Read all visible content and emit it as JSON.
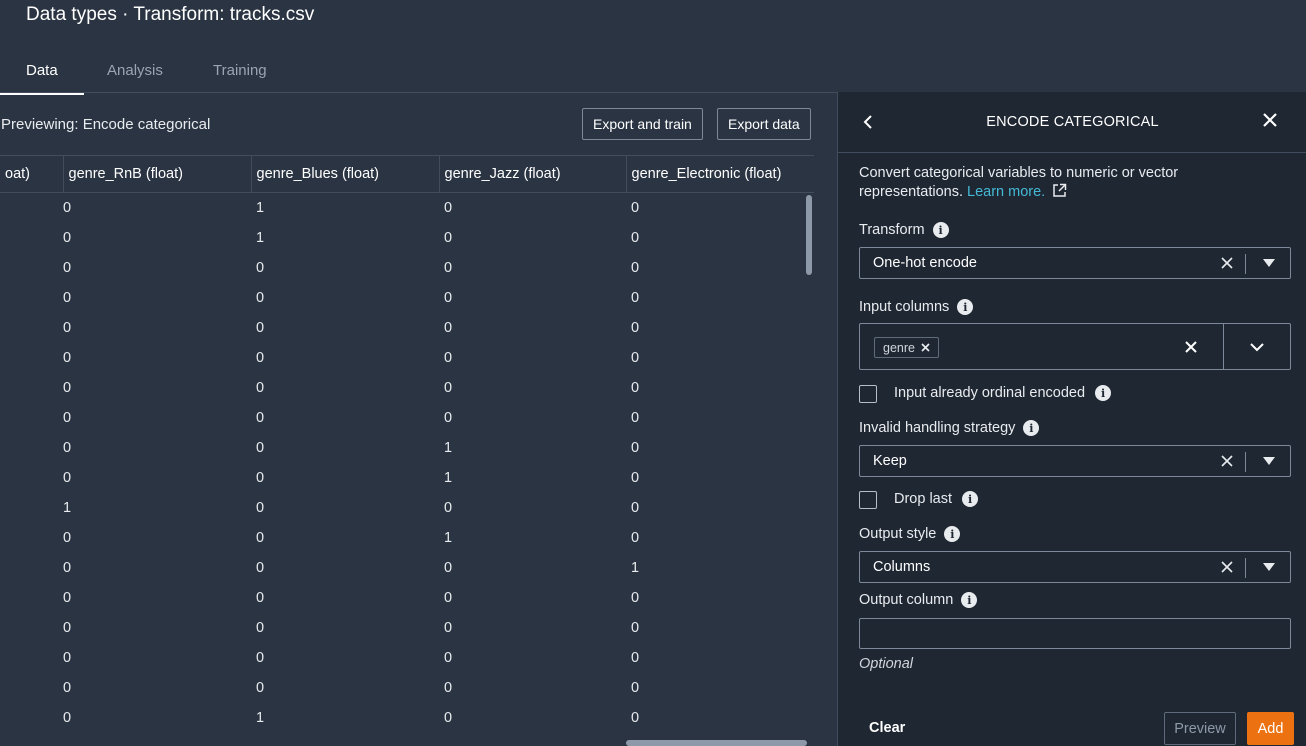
{
  "header": {
    "title": "Data types · Transform: tracks.csv"
  },
  "tabs": [
    {
      "label": "Data",
      "active": true
    },
    {
      "label": "Analysis",
      "active": false
    },
    {
      "label": "Training",
      "active": false
    }
  ],
  "preview": {
    "label": "Previewing: Encode categorical",
    "export_train_label": "Export and train",
    "export_data_label": "Export data"
  },
  "table": {
    "columns": [
      "oat)",
      "genre_RnB (float)",
      "genre_Blues (float)",
      "genre_Jazz (float)",
      "genre_Electronic (float)"
    ],
    "rows": [
      [
        "0",
        "1",
        "0",
        "0"
      ],
      [
        "0",
        "1",
        "0",
        "0"
      ],
      [
        "0",
        "0",
        "0",
        "0"
      ],
      [
        "0",
        "0",
        "0",
        "0"
      ],
      [
        "0",
        "0",
        "0",
        "0"
      ],
      [
        "0",
        "0",
        "0",
        "0"
      ],
      [
        "0",
        "0",
        "0",
        "0"
      ],
      [
        "0",
        "0",
        "0",
        "0"
      ],
      [
        "0",
        "0",
        "1",
        "0"
      ],
      [
        "0",
        "0",
        "1",
        "0"
      ],
      [
        "1",
        "0",
        "0",
        "0"
      ],
      [
        "0",
        "0",
        "1",
        "0"
      ],
      [
        "0",
        "0",
        "0",
        "1"
      ],
      [
        "0",
        "0",
        "0",
        "0"
      ],
      [
        "0",
        "0",
        "0",
        "0"
      ],
      [
        "0",
        "0",
        "0",
        "0"
      ],
      [
        "0",
        "0",
        "0",
        "0"
      ],
      [
        "0",
        "1",
        "0",
        "0"
      ]
    ]
  },
  "panel": {
    "title": "ENCODE CATEGORICAL",
    "description": "Convert categorical variables to numeric or vector representations.",
    "learn_more": "Learn more.",
    "transform": {
      "label": "Transform",
      "value": "One-hot encode"
    },
    "input_columns": {
      "label": "Input columns",
      "token": "genre"
    },
    "ordinal": {
      "label": "Input already ordinal encoded",
      "checked": false
    },
    "invalid": {
      "label": "Invalid handling strategy",
      "value": "Keep"
    },
    "drop_last": {
      "label": "Drop last",
      "checked": false
    },
    "output_style": {
      "label": "Output style",
      "value": "Columns"
    },
    "output_column": {
      "label": "Output column",
      "value": "",
      "hint": "Optional"
    },
    "clear_label": "Clear",
    "preview_label": "Preview",
    "add_label": "Add"
  },
  "colors": {
    "accent": "#ec7211",
    "link": "#44b9d6",
    "background": "#2a3442",
    "panel": "#1f2733"
  }
}
